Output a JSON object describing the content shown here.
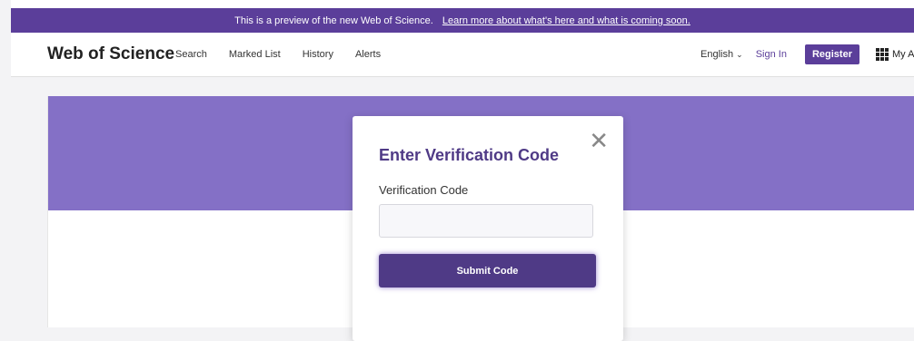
{
  "banner": {
    "text": "This is a preview of the new Web of Science.",
    "link_text": "Learn more about what's here and what is coming soon."
  },
  "header": {
    "brand": "Web of Science",
    "nav": [
      "Search",
      "Marked List",
      "History",
      "Alerts"
    ],
    "language": "English",
    "sign_in": "Sign In",
    "register": "Register",
    "apps": "My Apps"
  },
  "modal": {
    "title": "Enter Verification Code",
    "field_label": "Verification Code",
    "input_value": "",
    "submit_label": "Submit Code"
  },
  "colors": {
    "brand_purple": "#5b3e9a",
    "hero_purple": "#8470c6",
    "button_purple": "#4f3a86"
  }
}
